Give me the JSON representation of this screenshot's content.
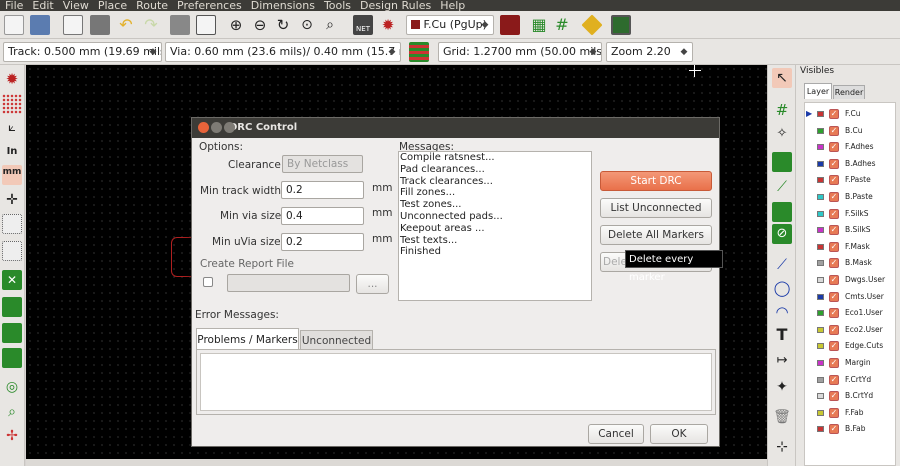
{
  "menu": [
    "File",
    "Edit",
    "View",
    "Place",
    "Route",
    "Preferences",
    "Dimensions",
    "Tools",
    "Design Rules",
    "Help"
  ],
  "toolbar2": {
    "track": "Track: 0.500 mm (19.69 mils) *",
    "via": "Via: 0.60 mm (23.6 mils)/ 0.40 mm (15.7 mils) *",
    "grid": "Grid: 1.2700 mm (50.00 mils)",
    "zoom": "Zoom 2.20",
    "layer": "F.Cu (PgUp)"
  },
  "visibles": {
    "title": "Visibles",
    "tabs": [
      "Layer",
      "Render"
    ],
    "layers": [
      {
        "name": "F.Cu",
        "color": "#c83434"
      },
      {
        "name": "B.Cu",
        "color": "#2ea02e"
      },
      {
        "name": "F.Adhes",
        "color": "#c833c8"
      },
      {
        "name": "B.Adhes",
        "color": "#1a3aa8"
      },
      {
        "name": "F.Paste",
        "color": "#c83434"
      },
      {
        "name": "B.Paste",
        "color": "#2ec8c8"
      },
      {
        "name": "F.SilkS",
        "color": "#2ec8c8"
      },
      {
        "name": "B.SilkS",
        "color": "#c833c8"
      },
      {
        "name": "F.Mask",
        "color": "#c83434"
      },
      {
        "name": "B.Mask",
        "color": "#a0a0a0"
      },
      {
        "name": "Dwgs.User",
        "color": "#d9d9d9"
      },
      {
        "name": "Cmts.User",
        "color": "#1a3aa8"
      },
      {
        "name": "Eco1.User",
        "color": "#2ea02e"
      },
      {
        "name": "Eco2.User",
        "color": "#c8c833"
      },
      {
        "name": "Edge.Cuts",
        "color": "#c8c833"
      },
      {
        "name": "Margin",
        "color": "#c833c8"
      },
      {
        "name": "F.CrtYd",
        "color": "#a0a0a0"
      },
      {
        "name": "B.CrtYd",
        "color": "#d9d9d9"
      },
      {
        "name": "F.Fab",
        "color": "#c8c833"
      },
      {
        "name": "B.Fab",
        "color": "#c83434"
      }
    ]
  },
  "dialog": {
    "title": "DRC Control",
    "options_label": "Options:",
    "clearance_label": "Clearance",
    "clearance_value": "By Netclass",
    "min_track_label": "Min track width",
    "min_track_value": "0.2",
    "min_via_label": "Min via size",
    "min_via_value": "0.4",
    "min_uvia_label": "Min uVia size",
    "min_uvia_value": "0.2",
    "unit": "mm",
    "report_label": "Create Report File",
    "browse": "...",
    "messages_label": "Messages:",
    "messages": [
      "Compile ratsnest...",
      "Pad clearances...",
      "Track clearances...",
      "Fill zones...",
      "Test zones...",
      "Unconnected pads...",
      "Keepout areas ...",
      "Test texts...",
      "Finished"
    ],
    "start_drc": "Start DRC",
    "list_unconnected": "List Unconnected",
    "delete_all": "Delete All Markers",
    "delete_partial": "Dele",
    "tooltip": "Delete every marker",
    "error_label": "Error Messages:",
    "tab_problems": "Problems / Markers",
    "tab_unconnected": "Unconnected",
    "cancel": "Cancel",
    "ok": "OK"
  }
}
